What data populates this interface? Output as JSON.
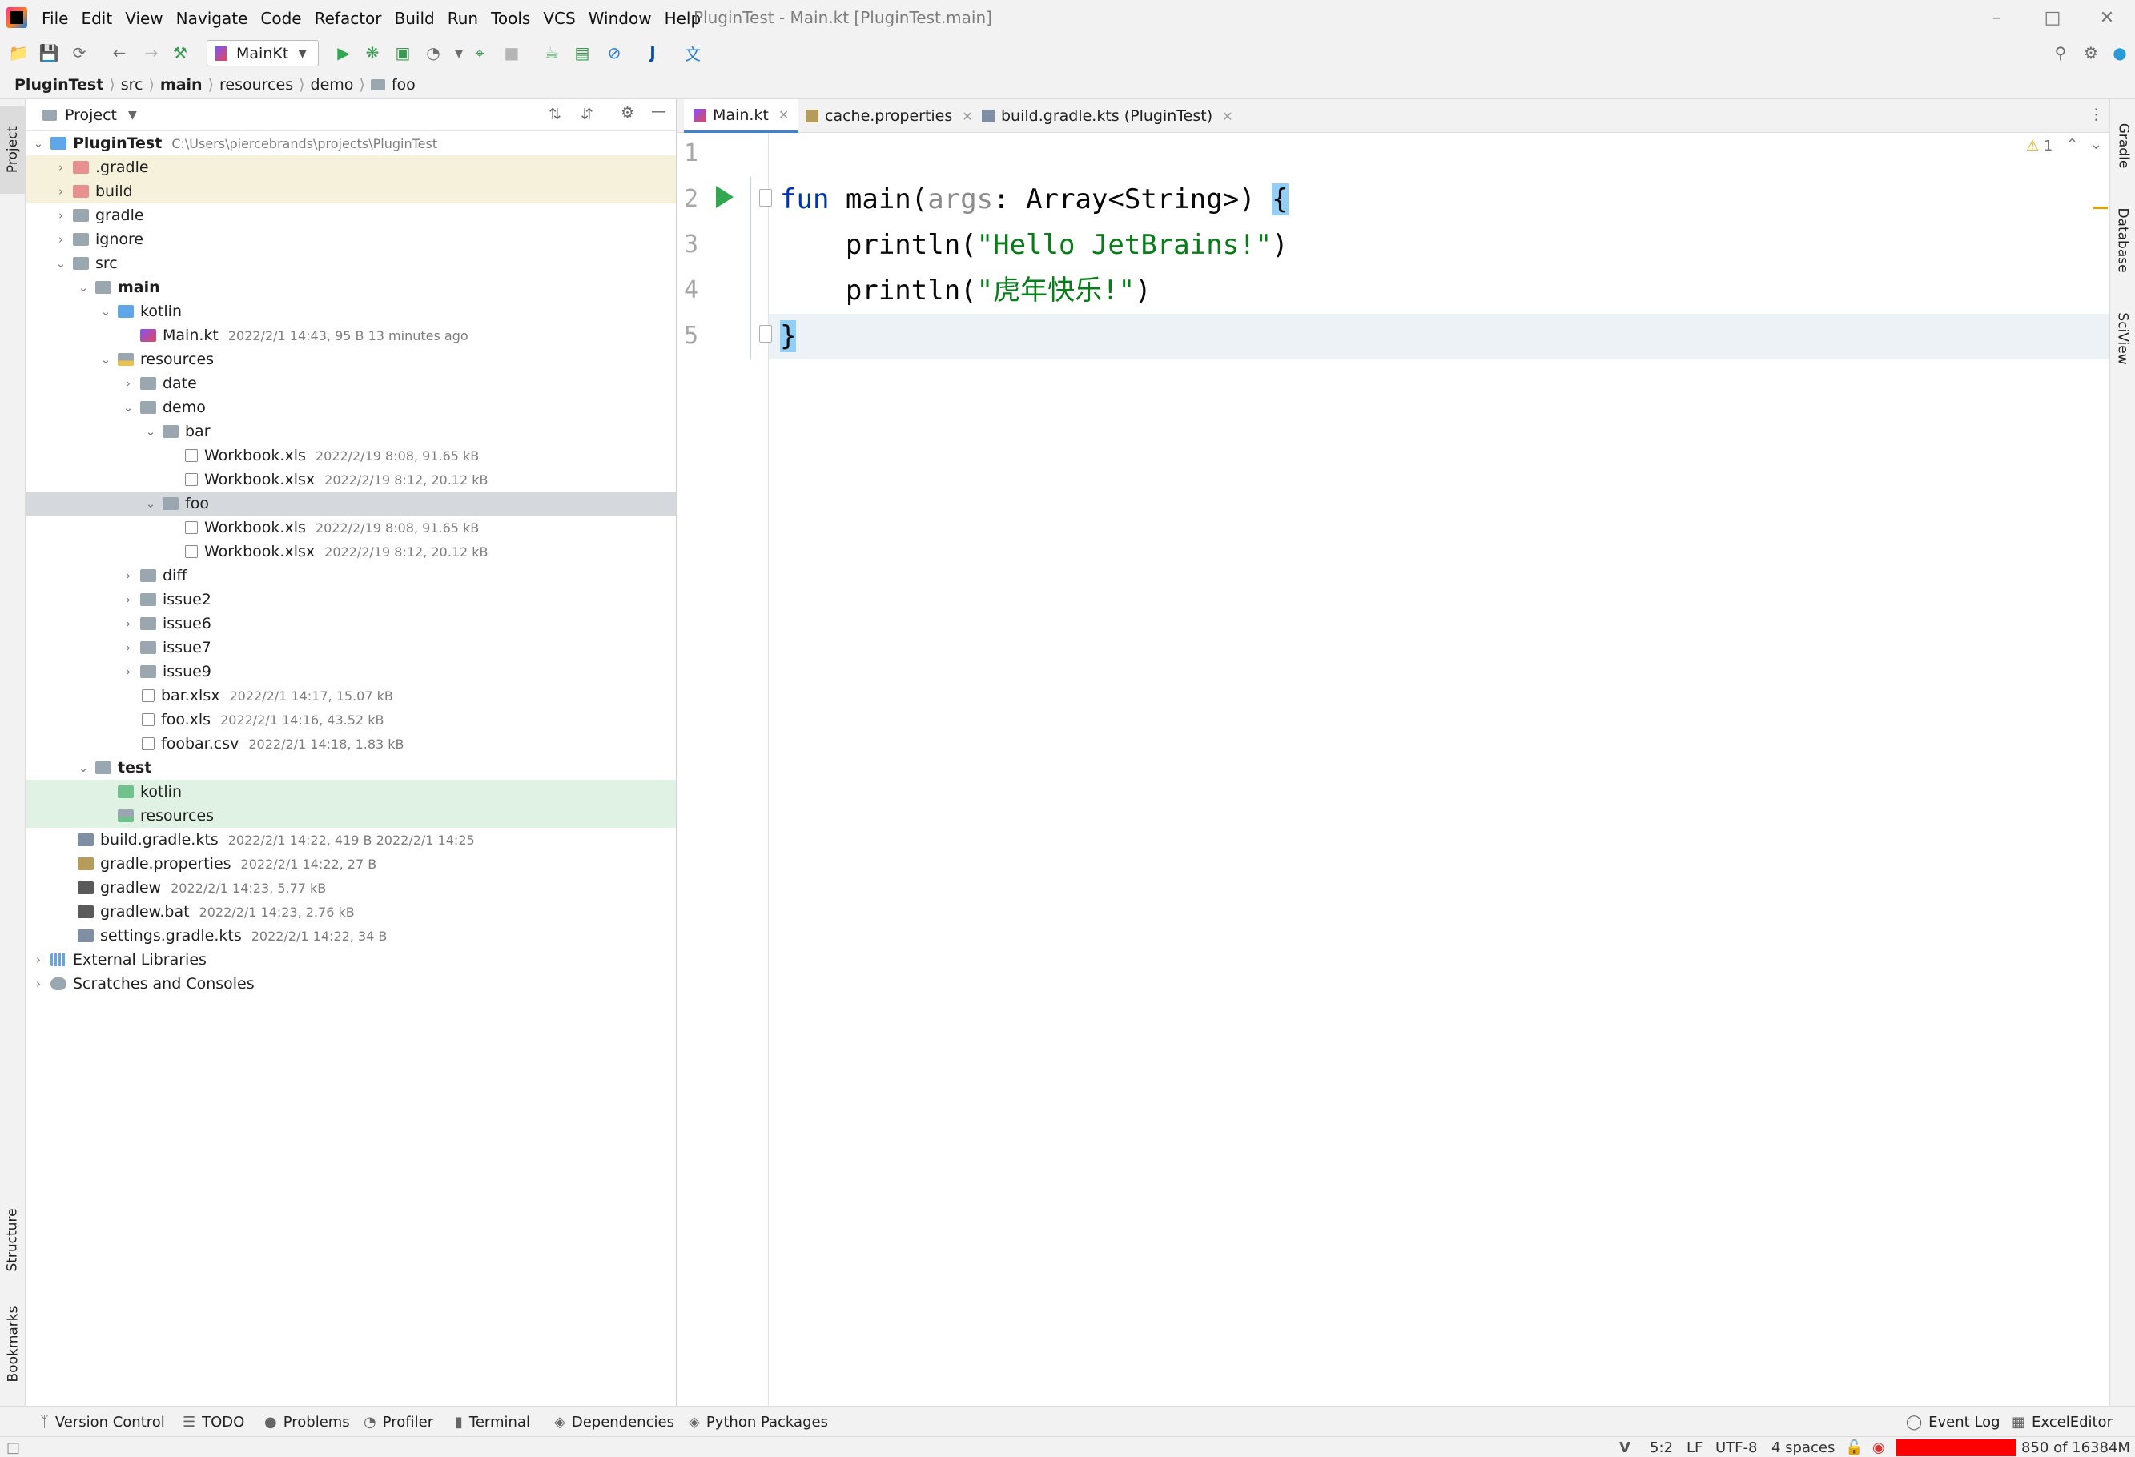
{
  "window": {
    "title": "PluginTest - Main.kt [PluginTest.main]",
    "menu": [
      "File",
      "Edit",
      "View",
      "Navigate",
      "Code",
      "Refactor",
      "Build",
      "Run",
      "Tools",
      "VCS",
      "Window",
      "Help"
    ]
  },
  "toolbar": {
    "run_config": "MainKt"
  },
  "breadcrumb": [
    "PluginTest",
    "src",
    "main",
    "resources",
    "demo",
    "foo"
  ],
  "side_tabs": {
    "left_top": "Project",
    "left_structure": "Structure",
    "left_bookmarks": "Bookmarks",
    "right": [
      "Gradle",
      "Database",
      "SciView"
    ]
  },
  "project_panel": {
    "title": "Project",
    "tree": [
      {
        "name": "PluginTest",
        "meta": "C:\\Users\\piercebrands\\projects\\PluginTest"
      },
      {
        "name": ".gradle",
        "meta": ""
      },
      {
        "name": "build",
        "meta": ""
      },
      {
        "name": "gradle",
        "meta": ""
      },
      {
        "name": "ignore",
        "meta": ""
      },
      {
        "name": "src",
        "meta": ""
      },
      {
        "name": "main",
        "meta": ""
      },
      {
        "name": "kotlin",
        "meta": ""
      },
      {
        "name": "Main.kt",
        "meta": "2022/2/1 14:43, 95 B 13 minutes ago"
      },
      {
        "name": "resources",
        "meta": ""
      },
      {
        "name": "date",
        "meta": ""
      },
      {
        "name": "demo",
        "meta": ""
      },
      {
        "name": "bar",
        "meta": ""
      },
      {
        "name": "Workbook.xls",
        "meta": "2022/2/19 8:08, 91.65 kB"
      },
      {
        "name": "Workbook.xlsx",
        "meta": "2022/2/19 8:12, 20.12 kB"
      },
      {
        "name": "foo",
        "meta": ""
      },
      {
        "name": "Workbook.xls",
        "meta": "2022/2/19 8:08, 91.65 kB"
      },
      {
        "name": "Workbook.xlsx",
        "meta": "2022/2/19 8:12, 20.12 kB"
      },
      {
        "name": "diff",
        "meta": ""
      },
      {
        "name": "issue2",
        "meta": ""
      },
      {
        "name": "issue6",
        "meta": ""
      },
      {
        "name": "issue7",
        "meta": ""
      },
      {
        "name": "issue9",
        "meta": ""
      },
      {
        "name": "bar.xlsx",
        "meta": "2022/2/1 14:17, 15.07 kB"
      },
      {
        "name": "foo.xls",
        "meta": "2022/2/1 14:16, 43.52 kB"
      },
      {
        "name": "foobar.csv",
        "meta": "2022/2/1 14:18, 1.83 kB"
      },
      {
        "name": "test",
        "meta": ""
      },
      {
        "name": "kotlin",
        "meta": ""
      },
      {
        "name": "resources",
        "meta": ""
      },
      {
        "name": "build.gradle.kts",
        "meta": "2022/2/1 14:22, 419 B 2022/2/1 14:25"
      },
      {
        "name": "gradle.properties",
        "meta": "2022/2/1 14:22, 27 B"
      },
      {
        "name": "gradlew",
        "meta": "2022/2/1 14:23, 5.77 kB"
      },
      {
        "name": "gradlew.bat",
        "meta": "2022/2/1 14:23, 2.76 kB"
      },
      {
        "name": "settings.gradle.kts",
        "meta": "2022/2/1 14:22, 34 B"
      },
      {
        "name": "External Libraries",
        "meta": ""
      },
      {
        "name": "Scratches and Consoles",
        "meta": ""
      }
    ]
  },
  "editor": {
    "tabs": [
      "Main.kt",
      "cache.properties",
      "build.gradle.kts (PluginTest)"
    ],
    "warnings": "1",
    "lines": [
      "1",
      "2",
      "3",
      "4",
      "5"
    ],
    "code": {
      "l2_kw": "fun",
      "l2_name": " main(",
      "l2_param": "args",
      "l2_rest": ": Array<String>) ",
      "l2_brace": "{",
      "l3_fn": "    println(",
      "l3_str": "\"Hello JetBrains!\"",
      "l3_end": ")",
      "l4_fn": "    println(",
      "l4_str": "\"虎年快乐!\"",
      "l4_end": ")",
      "l5": "}"
    }
  },
  "bottom_tools": [
    "Version Control",
    "TODO",
    "Problems",
    "Profiler",
    "Terminal",
    "Dependencies",
    "Python Packages",
    "Event Log",
    "ExcelEditor"
  ],
  "status": {
    "position": "5:2",
    "line_sep": "LF",
    "encoding": "UTF-8",
    "indent": "4 spaces",
    "memory": "850 of 16384M"
  }
}
